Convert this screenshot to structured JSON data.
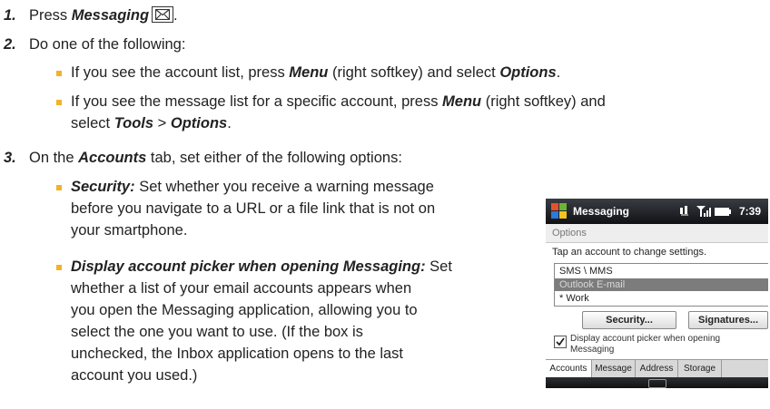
{
  "steps": [
    {
      "number": "1.",
      "prefix": "Press ",
      "bold": "Messaging",
      "icon": "envelope-icon"
    },
    {
      "number": "2.",
      "text": "Do one of the following:",
      "bullets": [
        {
          "parts": [
            "If you see the account list, press ",
            "Menu",
            " (right softkey) and select ",
            "Options",
            "."
          ]
        },
        {
          "parts": [
            "If you see the message list for a specific account, press ",
            "Menu",
            " (right softkey) and",
            "select ",
            "Tools",
            " > ",
            "Options",
            "."
          ]
        }
      ]
    },
    {
      "number": "3.",
      "parts": [
        "On the ",
        "Accounts",
        " tab, set either of the following options:"
      ],
      "bullets": [
        {
          "term": "Security:",
          "lines": [
            " Set whether you receive a warning message",
            "before you navigate to a URL or a file link that is not on",
            "your smartphone."
          ]
        },
        {
          "term": "Display account picker when opening Messaging:",
          "lines": [
            " Set",
            "whether a list of your email accounts appears when",
            "you open the Messaging application, allowing you to",
            "select the one you want to use. (If the box is",
            "unchecked, the Inbox application opens to the last",
            "account you used.)"
          ]
        }
      ]
    }
  ],
  "phone": {
    "title": "Messaging",
    "time": "7:39",
    "subheader": "Options",
    "hint": "Tap an account to change settings.",
    "accounts": [
      "SMS \\ MMS",
      "Outlook E-mail",
      "* Work"
    ],
    "selected_index": 1,
    "buttons": [
      "Security...",
      "Signatures..."
    ],
    "checkbox_label_1": "Display account picker when opening",
    "checkbox_label_2": "Messaging",
    "checkbox_checked": true,
    "tabs": [
      "Accounts",
      "Message",
      "Address",
      "Storage"
    ],
    "active_tab": 0,
    "colors": {
      "bullet": "#f0b32a",
      "selection": "#7c7c7c"
    }
  }
}
